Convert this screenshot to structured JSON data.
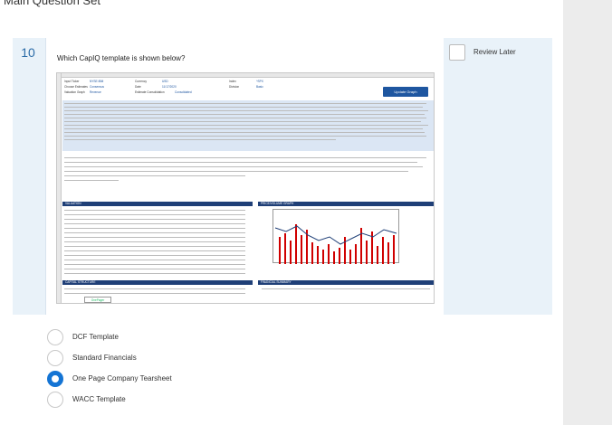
{
  "page": {
    "title": "Main Question Set"
  },
  "question": {
    "number": "10",
    "text": "Which CapIQ template is shown below?",
    "review_label": "Review Later"
  },
  "screenshot": {
    "fields": {
      "input_ticker_label": "Input Ticker",
      "input_ticker_value": "NYSE:IBM",
      "currency_label": "Currency",
      "currency_value": "USD",
      "choose_estimates_label": "Choose Estimates",
      "choose_estimates_value": "Consensus",
      "date_label": "Date",
      "date_value": "11/17/2020",
      "valuation_graph_label": "Valuation Graph",
      "valuation_graph_value": "Revenue",
      "estimate_consolidation_label": "Estimate Consolidation",
      "estimate_consolidation_value": "Consolidated",
      "index_label": "Index",
      "index_value": "^SPX",
      "division_label": "Division",
      "division_value": "Basic",
      "update_button": "Update Graph"
    },
    "section_valuation": "VALUATION",
    "section_price_volume": "PRICE/VOLUME GRAPH",
    "section_capital": "CAPITAL STRUCTURE",
    "section_financial": "FINANCIAL SUMMARY",
    "sheet_tab": "OnePager"
  },
  "options": [
    {
      "label": "DCF Template",
      "selected": false
    },
    {
      "label": "Standard Financials",
      "selected": false
    },
    {
      "label": "One Page Company Tearsheet",
      "selected": true
    },
    {
      "label": "WACC Template",
      "selected": false
    }
  ]
}
